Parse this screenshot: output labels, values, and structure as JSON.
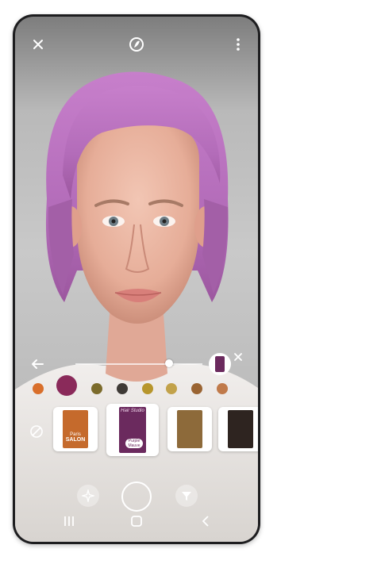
{
  "colors": {
    "selected_hair": "#8a2a5a",
    "accent_pink": "#d874c9"
  },
  "swatches": [
    {
      "name": "orange",
      "color": "#d96f2b"
    },
    {
      "name": "plum",
      "color": "#8a2a5a",
      "selected": true
    },
    {
      "name": "olive",
      "color": "#7b6b2b"
    },
    {
      "name": "charcoal",
      "color": "#3e3a36"
    },
    {
      "name": "mustard",
      "color": "#b7962c"
    },
    {
      "name": "gold",
      "color": "#c2a24a"
    },
    {
      "name": "brown",
      "color": "#9a6432"
    },
    {
      "name": "copper",
      "color": "#c07a4a"
    }
  ],
  "slider": {
    "level": 0.74
  },
  "products": [
    {
      "brand": "Paris",
      "line": "SALON",
      "color": "#c56a2c",
      "selected": false
    },
    {
      "brand": "Hair Studio",
      "line": "Purple Mauve",
      "color": "#6b2a5e",
      "selected": true
    },
    {
      "brand": "",
      "line": "",
      "color": "#8d6a3a",
      "selected": false
    },
    {
      "brand": "",
      "line": "",
      "color": "#2e2420",
      "selected": false
    }
  ],
  "icons": {
    "close": "close-icon",
    "logo": "brand-logo-icon",
    "menu": "more-vert-icon",
    "back": "arrow-left-icon",
    "dismiss": "close-small-icon",
    "none": "no-color-icon",
    "effects": "sparkle-icon",
    "capture": "shutter-icon",
    "filter": "filter-icon"
  }
}
